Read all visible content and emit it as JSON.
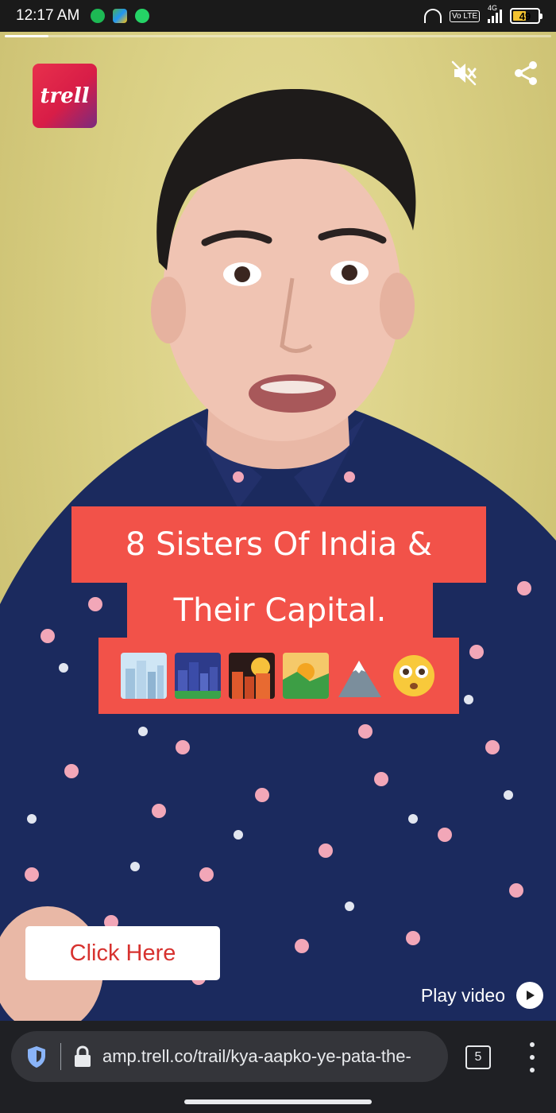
{
  "status_bar": {
    "time": "12:17 AM",
    "notification_icons": [
      "spotify-icon",
      "gallery-icon",
      "whatsapp-icon"
    ],
    "volte": "Vo LTE",
    "network": "4G",
    "battery": "49"
  },
  "video": {
    "progress": 0.08,
    "brand": "trell",
    "caption": {
      "line1": "8 Sisters Of India &",
      "line2": "Their Capital.",
      "emojis": [
        "cityscape",
        "night-city",
        "city-dusk",
        "sunrise-over-mountains",
        "snow-capped-mountain",
        "flushed-face"
      ]
    },
    "cta_label": "Click Here",
    "play_label": "Play video",
    "icons": [
      "mute-icon",
      "share-icon",
      "play-icon"
    ]
  },
  "browser": {
    "url": "amp.trell.co/trail/kya-aapko-ye-pata-the-",
    "tab_count": "5"
  },
  "colors": {
    "caption_bg": "#f25249",
    "cta_text": "#d7322f",
    "browser_bg": "#1f2024"
  }
}
